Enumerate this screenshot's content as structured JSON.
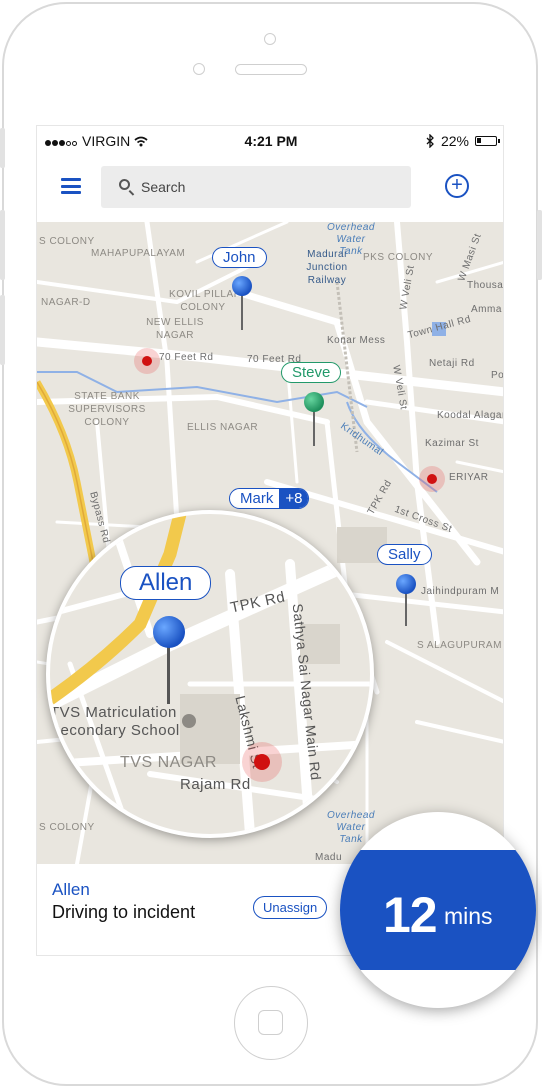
{
  "status_bar": {
    "carrier": "VIRGIN",
    "time": "4:21 PM",
    "battery": "22%"
  },
  "topbar": {
    "search_placeholder": "Search"
  },
  "map": {
    "labels": {
      "s_colony": "S COLONY",
      "mahapupalayam": "MAHAPUPALAYAM",
      "nagar_d": "NAGAR-D",
      "kovil_pillai_colony": "KOVIL PILLAI COLONY",
      "new_ellis_nagar": "NEW ELLIS NAGAR",
      "state_bank": "STATE BANK SUPERVISORS COLONY",
      "ellis_nagar": "ELLIS NAGAR",
      "seventy_feet_rd_1": "70 Feet Rd",
      "seventy_feet_rd_2": "70 Feet Rd",
      "overhead_water_tank": "Overhead Water Tank",
      "madurai_junction": "Madurai Junction Railway",
      "pks_colony": "PKS COLONY",
      "konar_mess": "Konar Mess",
      "w_veli_st_1": "W Veli St",
      "w_veli_st_2": "W Veli St",
      "w_masi_st": "W Masi St",
      "town_hall_rd": "Town Hall Rd",
      "netaji_rd": "Netaji Rd",
      "koodal_alagar": "Koodal Alagar T",
      "kazimar_st": "Kazimar St",
      "periyar": "ERIYAR",
      "kridhumal": "Kridhumal",
      "tpk_rd_map": "TPK Rd",
      "first_cross_st": "1st Cross St",
      "bypass_rd": "Bypass Rd",
      "jaihindpuram": "Jaihindpuram M",
      "s_alagupuram": "S ALAGUPURAM",
      "thousand": "Thousar",
      "amma": "Amma",
      "po": "Po",
      "s_colony_2": "S COLONY",
      "overhead_water_tank_2": "Overhead Water Tank",
      "madu": "Madu"
    },
    "markers": {
      "john": "John",
      "steve": "Steve",
      "mark": "Mark",
      "mark_more": "+8",
      "sally": "Sally",
      "allen": "Allen"
    },
    "magnifier_labels": {
      "tpk_rd": "TPK Rd",
      "sathya_sai": "Sathya Sai Nagar Main Rd",
      "lakshmi_st": "Lakshmi St",
      "tvs_school": "TVS Matriculation Secondary School",
      "tvs_nagar": "TVS NAGAR",
      "rajam_rd": "Rajam Rd"
    }
  },
  "bottom": {
    "driver_name": "Allen",
    "driver_status": "Driving to incident",
    "unassign_label": "Unassign"
  },
  "eta": {
    "value": "12",
    "unit": "mins"
  },
  "colors": {
    "accent": "#1a52c2",
    "green": "#22996a",
    "red": "#d01010"
  }
}
